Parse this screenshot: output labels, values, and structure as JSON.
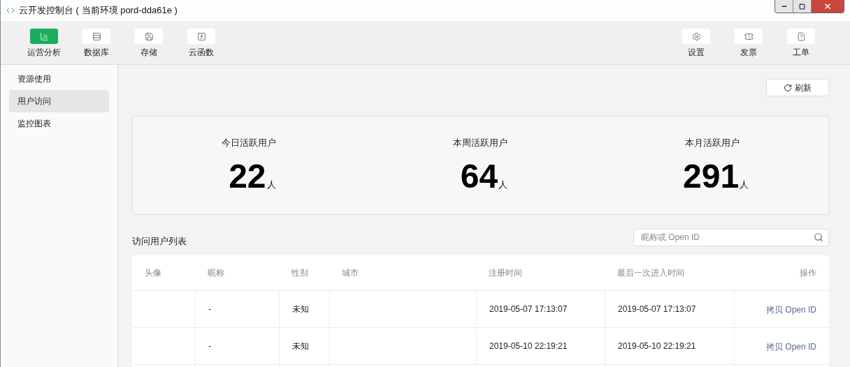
{
  "window": {
    "title": "云开发控制台 ( 当前环境 pord-dda61e )"
  },
  "toolbar_left": [
    {
      "kind": "chart",
      "label": "运营分析",
      "selected": true
    },
    {
      "kind": "database",
      "label": "数据库",
      "selected": false
    },
    {
      "kind": "storage",
      "label": "存储",
      "selected": false
    },
    {
      "kind": "function",
      "label": "云函数",
      "selected": false
    }
  ],
  "toolbar_right": [
    {
      "kind": "settings",
      "label": "设置"
    },
    {
      "kind": "invoice",
      "label": "发票"
    },
    {
      "kind": "ticket",
      "label": "工单"
    }
  ],
  "sidebar": {
    "items": [
      {
        "label": "资源使用",
        "selected": false
      },
      {
        "label": "用户访问",
        "selected": true
      },
      {
        "label": "监控图表",
        "selected": false
      }
    ]
  },
  "refresh_button": "刷新",
  "stats": [
    {
      "label": "今日活跃用户",
      "value": "22",
      "unit": "人"
    },
    {
      "label": "本周活跃用户",
      "value": "64",
      "unit": "人"
    },
    {
      "label": "本月活跃用户",
      "value": "291",
      "unit": "人"
    }
  ],
  "user_list": {
    "title": "访问用户列表",
    "search": {
      "placeholder": "昵称或 Open ID"
    },
    "columns": [
      "头像",
      "昵称",
      "性别",
      "城市",
      "注册时间",
      "最后一次进入时间",
      "操作"
    ],
    "rows": [
      {
        "nickname": "-",
        "gender": "未知",
        "registered": "2019-05-07 17:13:07",
        "last_visit": "2019-05-07 17:13:07",
        "action": "拷贝 Open ID"
      },
      {
        "nickname": "-",
        "gender": "未知",
        "registered": "2019-05-10 22:19:21",
        "last_visit": "2019-05-10 22:19:21",
        "action": "拷贝 Open ID"
      }
    ]
  }
}
